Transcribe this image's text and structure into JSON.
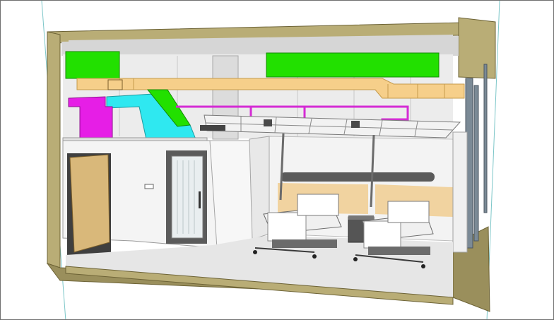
{
  "viewport": {
    "content_type": "3d-model-view",
    "background": "#ffffff",
    "guide_line_color": "#7cc6c8"
  },
  "colors": {
    "wall_section": "#8a7d4a",
    "wall_fill": "#b9ad76",
    "floor_slab": "#9a8f5c",
    "floor_finish": "#e6e6e6",
    "supply_duct": "#f6cf8a",
    "green_duct": "#22e000",
    "cyan_duct": "#2fe8f0",
    "magenta_equipment": "#e61ee6",
    "magenta_pipe": "#d42bd4",
    "door_wood": "#d9b87a",
    "interior_wall": "#f4f4f4",
    "ceiling_grid": "#7a7a7a",
    "headwall_rail": "#5a5a5a",
    "bed": "#f0f0f0",
    "cabinet": "#555555",
    "steel_frame": "#7b8a96"
  },
  "objects": {
    "bed_count": 2
  }
}
